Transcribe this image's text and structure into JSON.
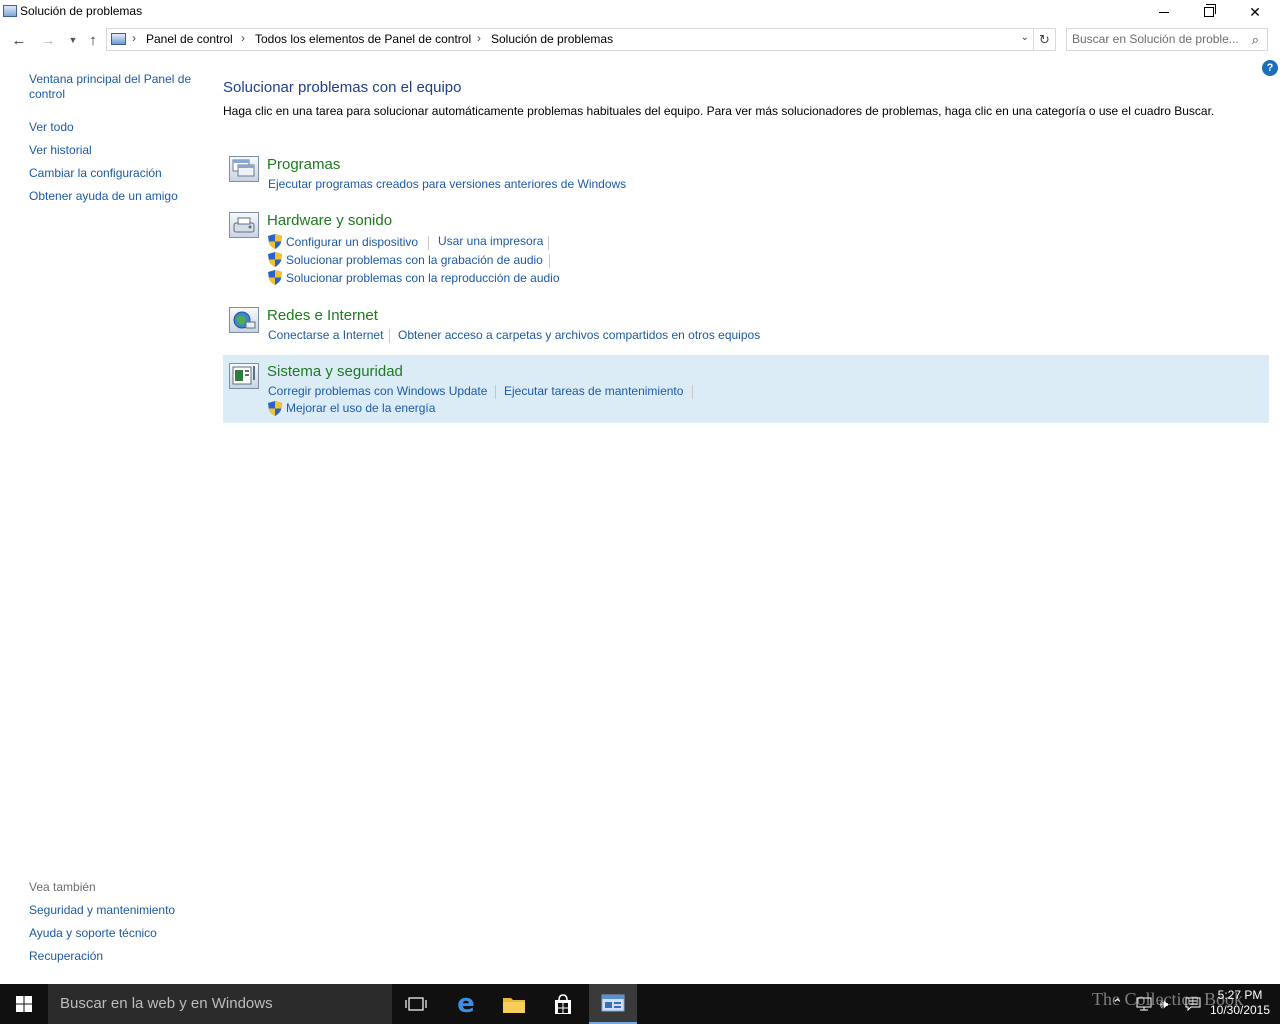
{
  "window": {
    "title": "Solución de problemas"
  },
  "address": {
    "breadcrumbs": [
      "Panel de control",
      "Todos los elementos de Panel de control",
      "Solución de problemas"
    ],
    "search_placeholder": "Buscar en Solución de proble..."
  },
  "help": {
    "label": "?"
  },
  "left_panel": {
    "main_link": "Ventana principal del Panel de control",
    "items": [
      "Ver todo",
      "Ver historial",
      "Cambiar la configuración",
      "Obtener ayuda de un amigo"
    ],
    "see_also_heading": "Vea también",
    "see_also_items": [
      "Seguridad y mantenimiento",
      "Ayuda y soporte técnico",
      "Recuperación"
    ]
  },
  "main": {
    "title": "Solucionar problemas con el equipo",
    "description": "Haga clic en una tarea para solucionar automáticamente problemas habituales del equipo. Para ver más solucionadores de problemas, haga clic en una categoría o use el cuadro Buscar."
  },
  "categories": [
    {
      "title": "Programas",
      "links": [
        "Ejecutar programas creados para versiones anteriores de Windows"
      ]
    },
    {
      "title": "Hardware y sonido",
      "links": [
        "Configurar un dispositivo",
        "Usar una impresora",
        "Solucionar problemas con la grabación de audio",
        "Solucionar problemas con la reproducción de audio"
      ]
    },
    {
      "title": "Redes e Internet",
      "links": [
        "Conectarse a Internet",
        "Obtener acceso a carpetas y archivos compartidos en otros equipos"
      ]
    },
    {
      "title": "Sistema y seguridad",
      "links": [
        "Corregir problemas con Windows Update",
        "Ejecutar tareas de mantenimiento",
        "Mejorar el uso de la energía"
      ]
    }
  ],
  "taskbar": {
    "search_placeholder": "Buscar en la web y en Windows",
    "time": "5:27 PM",
    "date": "10/30/2015",
    "watermark": "The Collection Book"
  },
  "colors": {
    "link": "#1c5aa8",
    "category_title": "#1e7b1e",
    "page_title": "#1e3f8a",
    "selected_row": "#dcecf7",
    "taskbar": "#101010"
  }
}
